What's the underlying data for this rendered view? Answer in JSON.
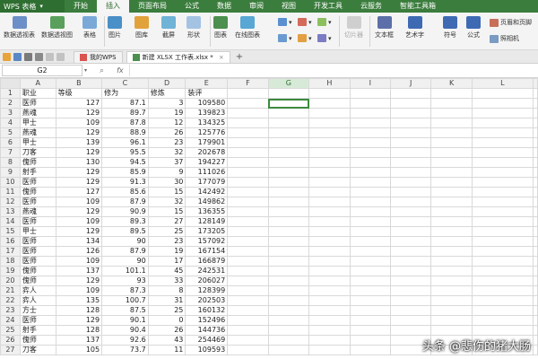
{
  "app": {
    "name": "WPS 表格"
  },
  "menu": [
    "开始",
    "插入",
    "页面布局",
    "公式",
    "数据",
    "审阅",
    "视图",
    "开发工具",
    "云服务",
    "智能工具箱"
  ],
  "active_menu_index": 1,
  "ribbon": {
    "pivot_table": "数据透视表",
    "pivot_chart": "数据透视图",
    "table": "表格",
    "picture": "图片",
    "gallery": "图库",
    "screenshot": "截屏",
    "shape": "形状",
    "chart": "图表",
    "online_chart": "在线图表",
    "slicer": "切片器",
    "textbox": "文本框",
    "art_text": "艺术字",
    "symbol": "符号",
    "formula": "公式",
    "header_footer": "页眉和页脚",
    "camera": "照相机"
  },
  "tabs": [
    {
      "label": "我的WPS",
      "active": false
    },
    {
      "label": "新建 XLSX 工作表.xlsx *",
      "active": true
    }
  ],
  "new_tab": "+",
  "namebox": "G2",
  "fx": "fx",
  "columns": [
    "A",
    "B",
    "C",
    "D",
    "E",
    "F",
    "G",
    "H",
    "I",
    "J",
    "K",
    "L"
  ],
  "header_row": [
    "职业",
    "等级",
    "修为",
    "修炼",
    "装评"
  ],
  "rows": [
    [
      "医师",
      "127",
      "87.1",
      "3",
      "109580"
    ],
    [
      "燕魂",
      "129",
      "89.7",
      "19",
      "139823"
    ],
    [
      "甲士",
      "109",
      "87.8",
      "12",
      "134325"
    ],
    [
      "燕魂",
      "129",
      "88.9",
      "26",
      "125776"
    ],
    [
      "甲士",
      "139",
      "96.1",
      "23",
      "179901"
    ],
    [
      "刀客",
      "129",
      "95.5",
      "32",
      "202678"
    ],
    [
      "傀师",
      "130",
      "94.5",
      "37",
      "194227"
    ],
    [
      "射手",
      "129",
      "85.9",
      "9",
      "111026"
    ],
    [
      "医师",
      "129",
      "91.3",
      "30",
      "177079"
    ],
    [
      "傀师",
      "127",
      "85.6",
      "15",
      "142492"
    ],
    [
      "医师",
      "109",
      "87.9",
      "32",
      "149862"
    ],
    [
      "燕魂",
      "129",
      "90.9",
      "15",
      "136355"
    ],
    [
      "医师",
      "109",
      "89.3",
      "27",
      "128149"
    ],
    [
      "甲士",
      "129",
      "89.5",
      "25",
      "173205"
    ],
    [
      "医师",
      "134",
      "90",
      "23",
      "157092"
    ],
    [
      "医师",
      "126",
      "87.9",
      "19",
      "167154"
    ],
    [
      "医师",
      "109",
      "90",
      "17",
      "166879"
    ],
    [
      "傀师",
      "137",
      "101.1",
      "45",
      "242531"
    ],
    [
      "傀师",
      "129",
      "93",
      "33",
      "206027"
    ],
    [
      "弈人",
      "109",
      "87.3",
      "8",
      "128399"
    ],
    [
      "弈人",
      "135",
      "100.7",
      "31",
      "202503"
    ],
    [
      "方士",
      "128",
      "87.5",
      "25",
      "160132"
    ],
    [
      "医师",
      "129",
      "90.1",
      "0",
      "152496"
    ],
    [
      "射手",
      "128",
      "90.4",
      "26",
      "144736"
    ],
    [
      "傀师",
      "137",
      "92.6",
      "43",
      "254469"
    ],
    [
      "刀客",
      "105",
      "73.7",
      "11",
      "109593"
    ]
  ],
  "watermark": "头条 @悲伤的猪大肠",
  "colors": {
    "brand": "#3b7d3d",
    "selection": "#3c8a3e"
  }
}
